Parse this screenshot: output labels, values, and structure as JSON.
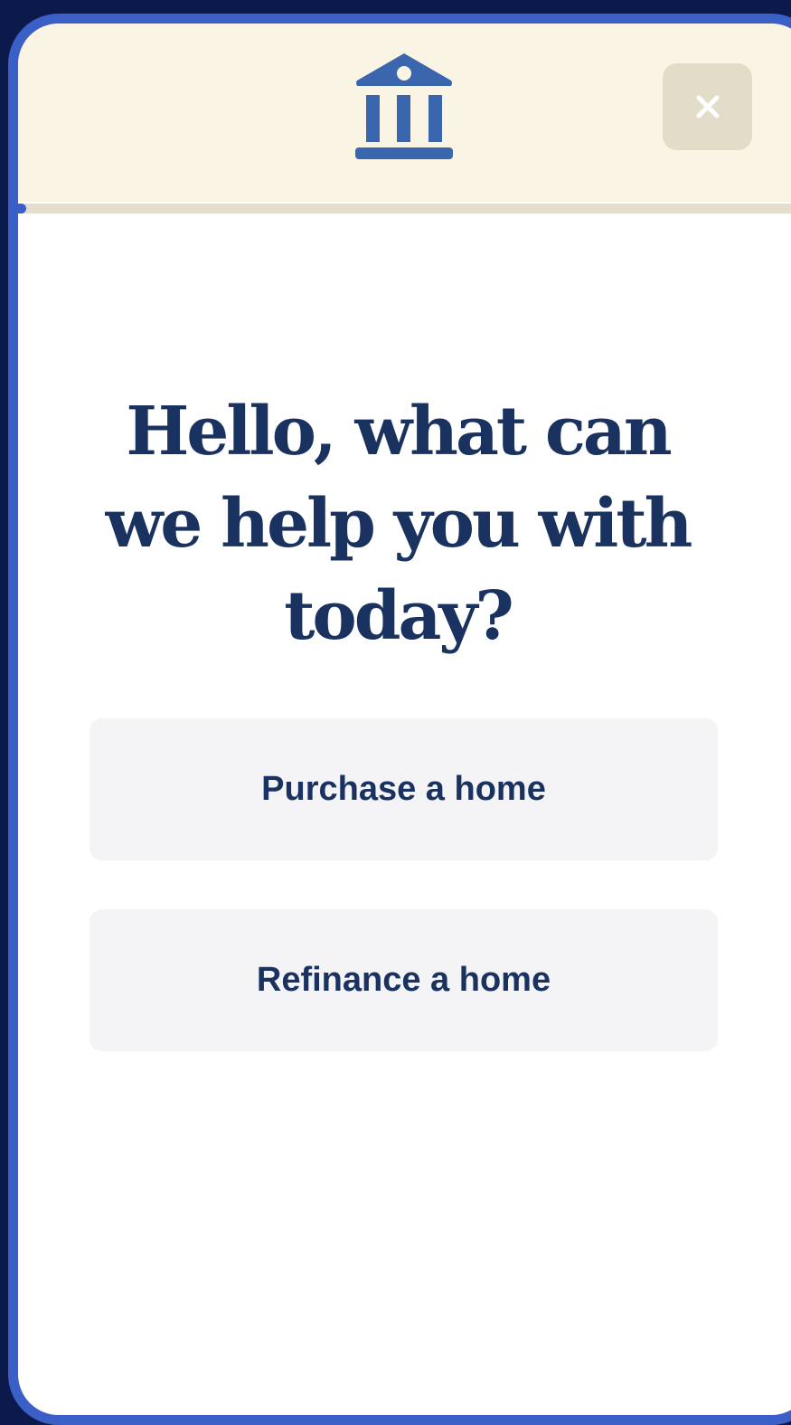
{
  "header": {
    "logo_icon": "bank-building-icon",
    "close_icon": "close-x-icon",
    "colors": {
      "background": "#faf4e4",
      "icon": "#3a66ae",
      "close_button_bg": "#e2dcc8"
    }
  },
  "progress": {
    "fraction": 0.01,
    "accent": "#3a5fc7"
  },
  "main": {
    "heading": "Hello, what can we help you with today?",
    "options": [
      {
        "label": "Purchase a home"
      },
      {
        "label": "Refinance a home"
      }
    ]
  },
  "theme": {
    "text_color": "#1a3260",
    "option_bg": "#f4f4f6",
    "frame_border": "#3a5fc7",
    "page_bg": "#0b1a4a"
  }
}
